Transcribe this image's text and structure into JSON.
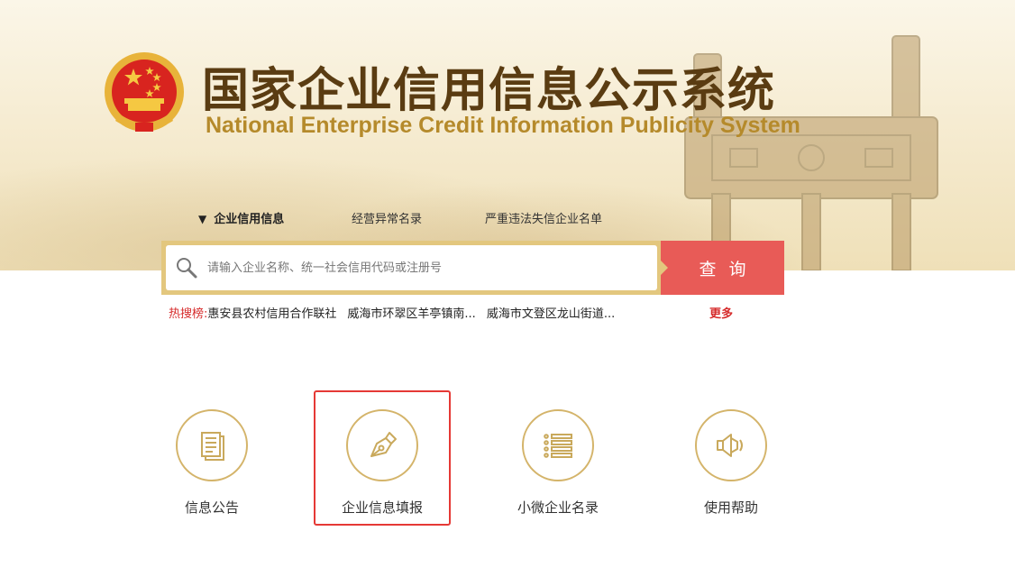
{
  "header": {
    "title_cn": "国家企业信用信息公示系统",
    "title_en": "National Enterprise Credit Information Publicity System"
  },
  "search": {
    "tabs": [
      {
        "label": "企业信用信息",
        "active": true
      },
      {
        "label": "经营异常名录",
        "active": false
      },
      {
        "label": "严重违法失信企业名单",
        "active": false
      }
    ],
    "placeholder": "请输入企业名称、统一社会信用代码或注册号",
    "button_label": "查询"
  },
  "hot_search": {
    "label": "热搜榜:",
    "items": [
      "惠安县农村信用合作联社",
      "威海市环翠区羊亭镇南...",
      "威海市文登区龙山街道..."
    ],
    "more_label": "更多"
  },
  "services": [
    {
      "label": "信息公告",
      "icon": "document-icon",
      "highlighted": false
    },
    {
      "label": "企业信息填报",
      "icon": "pen-nib-icon",
      "highlighted": true
    },
    {
      "label": "小微企业名录",
      "icon": "list-icon",
      "highlighted": false
    },
    {
      "label": "使用帮助",
      "icon": "speaker-icon",
      "highlighted": false
    }
  ],
  "colors": {
    "gold": "#d4b46a",
    "title_brown": "#5a3c12",
    "search_red": "#e85b57",
    "highlight_red": "#e53935",
    "hot_red": "#d62b2b"
  }
}
